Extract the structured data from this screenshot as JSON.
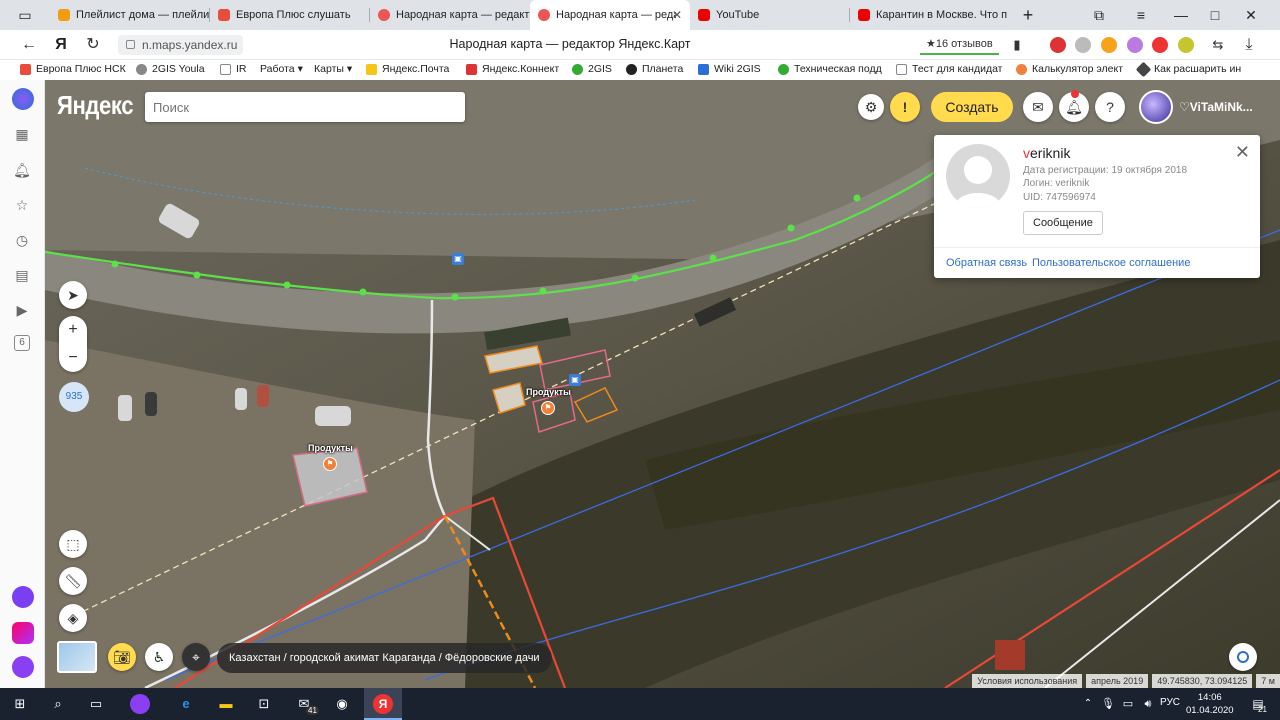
{
  "tabs": [
    {
      "label": "Плейлист дома — плейлис",
      "color": "#f39c12"
    },
    {
      "label": "Европа Плюс слушать",
      "color": "#e74c3c"
    },
    {
      "label": "Народная карта — редакт",
      "color": "#e55"
    },
    {
      "label": "Народная карта — редакт",
      "color": "#e55"
    },
    {
      "label": "YouTube",
      "color": "#e00"
    },
    {
      "label": "Карантин в Москве. Что п",
      "color": "#e00"
    }
  ],
  "address": {
    "url": "n.maps.yandex.ru",
    "page_title": "Народная карта — редактор Яндекс.Карт",
    "reviews": "★16 отзывов",
    "yandex_glyph": "Я"
  },
  "bookmarks": [
    "Европа Плюс НСК",
    "2GIS Youla",
    "IR",
    "Работа ▾",
    "Карты ▾",
    "Яндекс.Почта",
    "Яндекс.Коннект",
    "2GIS",
    "Планета",
    "Wiki 2GIS",
    "Техническая подд",
    "Тест для кандидат",
    "Калькулятор элект",
    "Как расшарить ин"
  ],
  "map": {
    "logo": "Яндекс",
    "search_placeholder": "Поиск",
    "create_label": "Создать",
    "username": "♡ViTaMiNk...",
    "zoom_level": "935",
    "zoom_in": "+",
    "zoom_out": "−",
    "breadcrumb": "Казахстан / городской акимат Караганда / Фёдоровские дачи",
    "terms": "Условия использования",
    "date": "апрель 2019",
    "coords": "49.745830, 73.094125",
    "scale": "7 м",
    "poi_label_1": "Продукты",
    "poi_label_2": "Продукты"
  },
  "card": {
    "username_first": "v",
    "username_rest": "eriknik",
    "reg_date": "Дата регистрации: 19 октября 2018",
    "login": "Логин: veriknik",
    "uid": "UID: 747596974",
    "message_button": "Сообщение",
    "feedback_link": "Обратная связь",
    "agreement_link": "Пользовательское соглашение"
  },
  "taskbar": {
    "time": "14:06",
    "date": "01.04.2020",
    "lang": "РУС",
    "mail_badge": "41",
    "notif_badge": "21"
  },
  "colors": {
    "accent_yellow": "#ffdb4d",
    "link_blue": "#2f6ec9",
    "road_green": "#5de04a"
  }
}
